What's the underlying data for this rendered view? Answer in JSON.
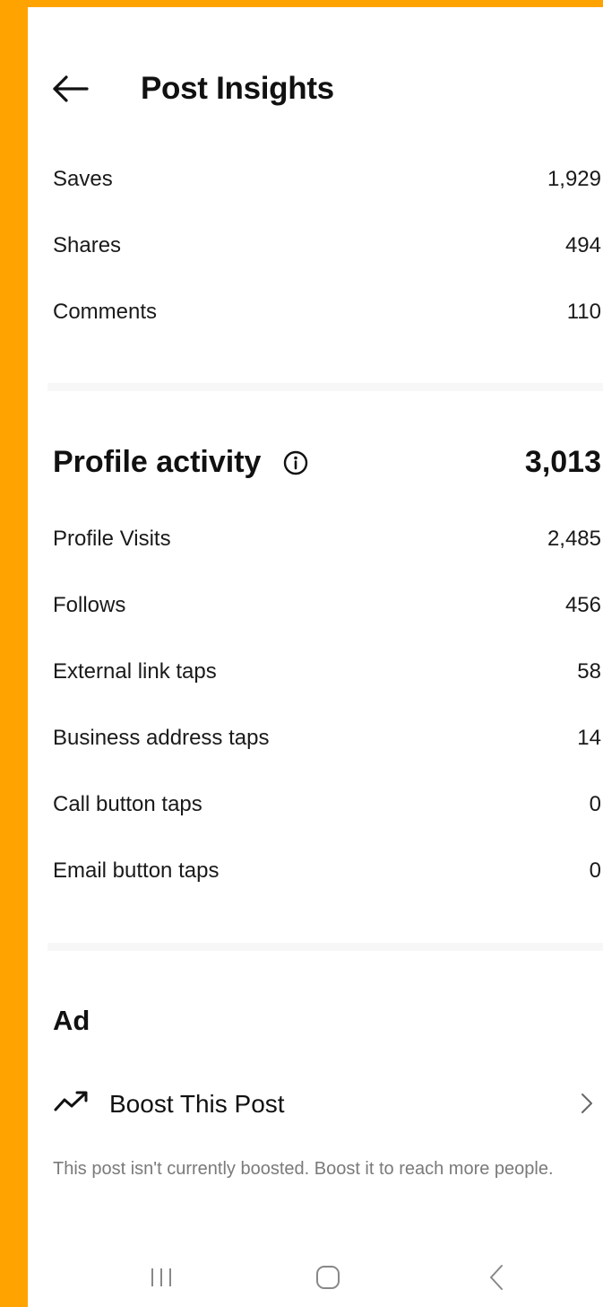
{
  "header": {
    "title": "Post Insights"
  },
  "interactions": [
    {
      "label": "Saves",
      "value": "1,929"
    },
    {
      "label": "Shares",
      "value": "494"
    },
    {
      "label": "Comments",
      "value": "110"
    }
  ],
  "profile_activity": {
    "title": "Profile activity",
    "total": "3,013",
    "rows": [
      {
        "label": "Profile Visits",
        "value": "2,485"
      },
      {
        "label": "Follows",
        "value": "456"
      },
      {
        "label": "External link taps",
        "value": "58"
      },
      {
        "label": "Business address taps",
        "value": "14"
      },
      {
        "label": "Call button taps",
        "value": "0"
      },
      {
        "label": "Email button taps",
        "value": "0"
      }
    ]
  },
  "ad": {
    "title": "Ad",
    "boost_label": "Boost This Post",
    "description": "This post isn't currently boosted. Boost it to reach more people."
  },
  "icons": {
    "back": "arrow-left-icon",
    "info": "info-circle-icon",
    "trend": "trending-up-icon",
    "chevron": "chevron-right-icon",
    "nav_recents": "recents-icon",
    "nav_home": "home-icon",
    "nav_back": "nav-back-icon"
  },
  "colors": {
    "frame_border": "#FFA300",
    "background": "#FFFFFF",
    "text_primary": "#111111",
    "text_secondary": "#7A7A7A",
    "divider": "#F7F7F7"
  }
}
